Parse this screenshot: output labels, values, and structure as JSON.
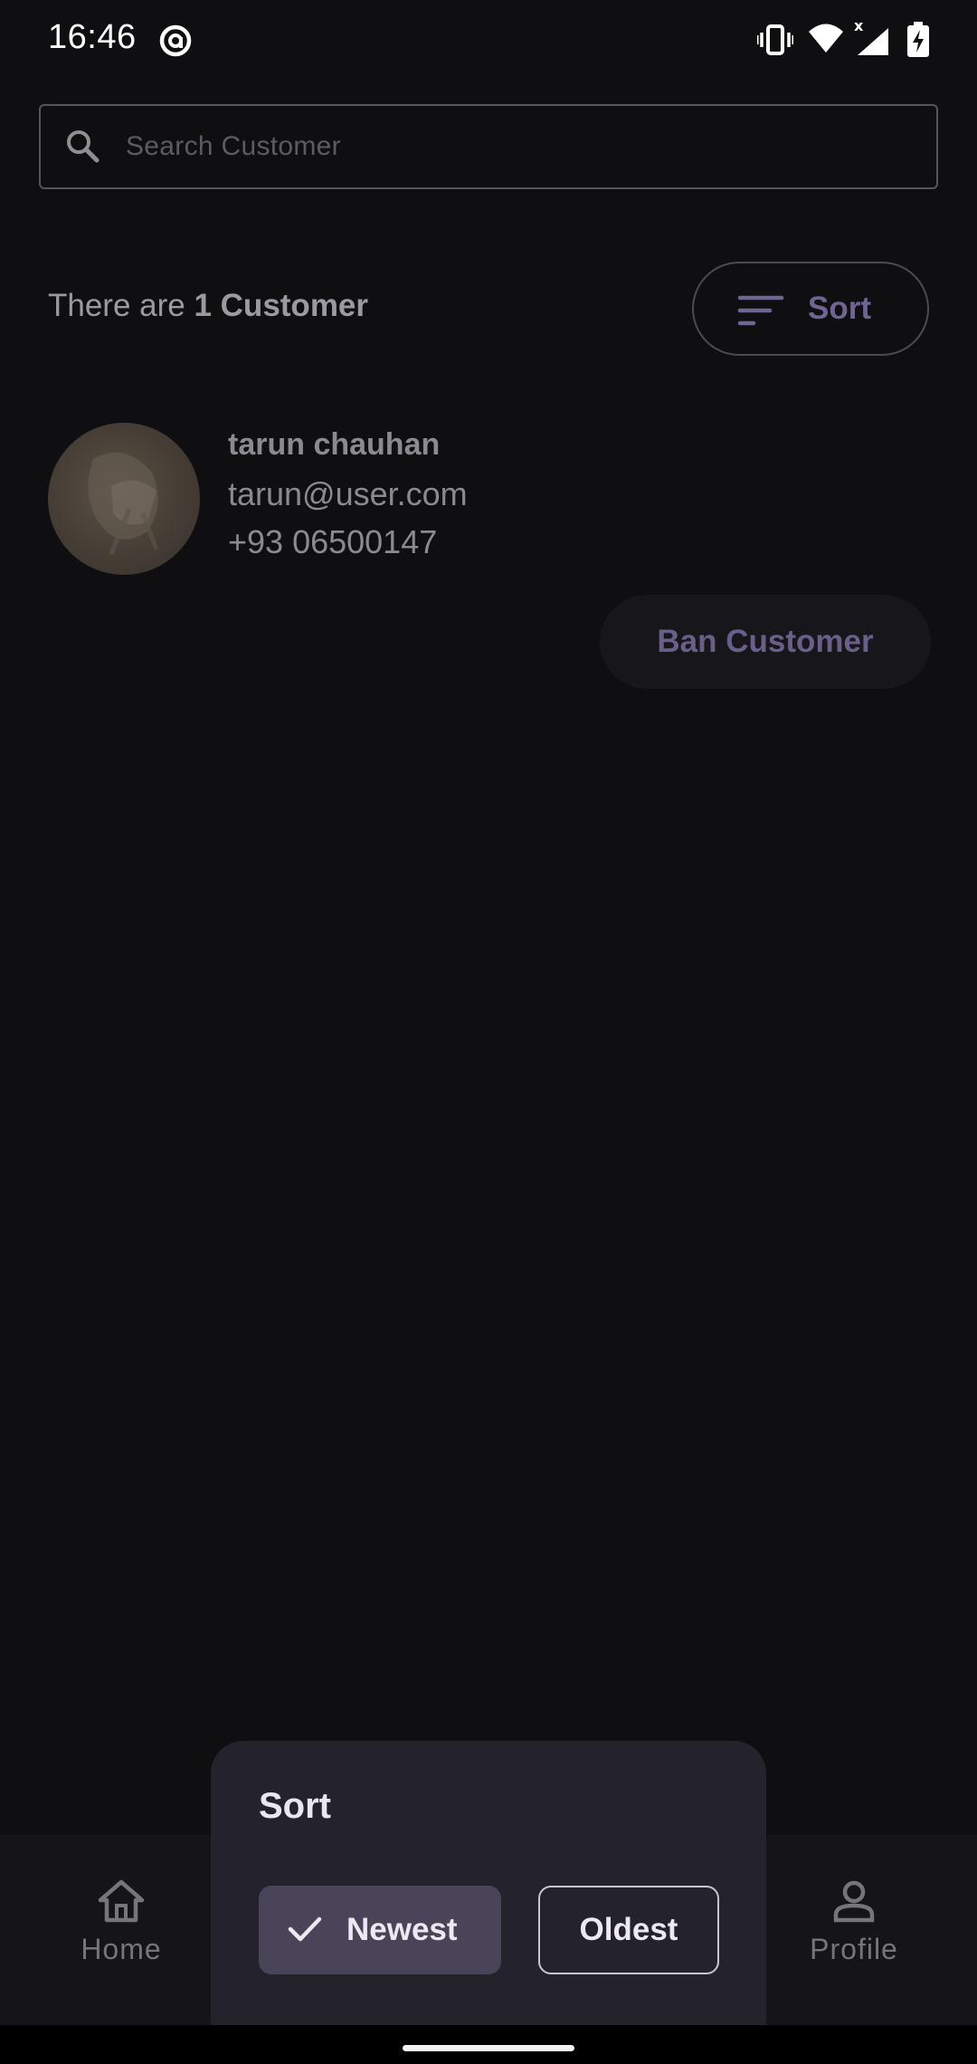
{
  "status_bar": {
    "time": "16:46",
    "icons": [
      "at-sign-icon",
      "vibrate-icon",
      "wifi-icon",
      "signal-icon",
      "battery-charging-icon"
    ]
  },
  "search": {
    "placeholder": "Search Customer",
    "value": ""
  },
  "summary": {
    "prefix": "There are ",
    "count_text": "1 Customer"
  },
  "sort_button": {
    "label": "Sort"
  },
  "customers": [
    {
      "name": "tarun chauhan",
      "email": "tarun@user.com",
      "phone": "+93 06500147",
      "action_label": "Ban Customer"
    }
  ],
  "bottom_nav": {
    "items": [
      {
        "label": "Home",
        "icon": "home-icon"
      },
      {
        "label": "Profile",
        "icon": "person-icon"
      }
    ]
  },
  "sort_sheet": {
    "title": "Sort",
    "options": [
      {
        "label": "Newest",
        "selected": true
      },
      {
        "label": "Oldest",
        "selected": false
      }
    ]
  },
  "colors": {
    "background": "#0f0f12",
    "accent": "#6a5f89",
    "sheet": "#24222b",
    "selected_chip": "#4a4459"
  }
}
